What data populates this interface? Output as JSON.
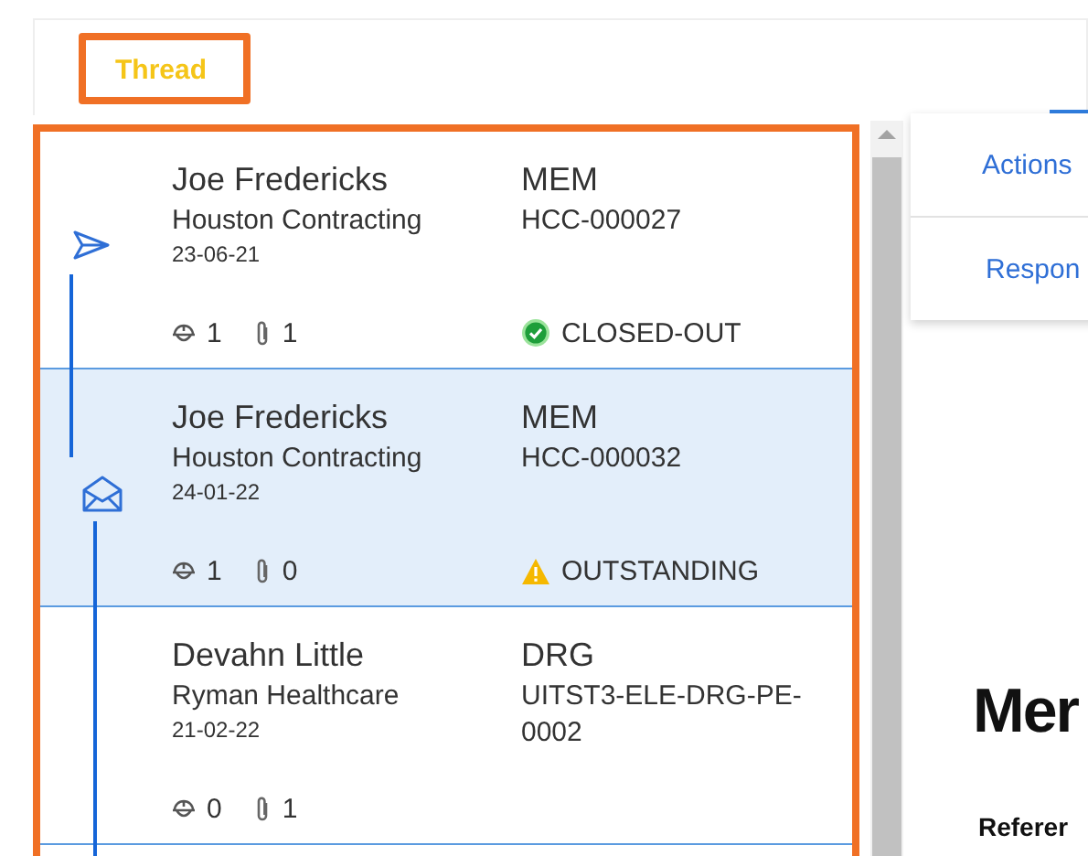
{
  "tabs": [
    {
      "label": "Thread",
      "selected": true,
      "highlighted": true
    }
  ],
  "thread": {
    "highlighted": true,
    "items": [
      {
        "kind": "sent",
        "sender": "Joe Fredericks",
        "company": "Houston Contracting",
        "date": "23-06-21",
        "doc_type": "MEM",
        "reference": "HCC-000027",
        "people_count": "1",
        "attachment_count": "1",
        "status": {
          "kind": "closed",
          "label": "CLOSED-OUT"
        },
        "selected": false
      },
      {
        "kind": "received",
        "sender": "Joe Fredericks",
        "company": "Houston Contracting",
        "date": "24-01-22",
        "doc_type": "MEM",
        "reference": "HCC-000032",
        "people_count": "1",
        "attachment_count": "0",
        "status": {
          "kind": "outstanding",
          "label": "OUTSTANDING"
        },
        "selected": true
      },
      {
        "kind": "none",
        "sender": "Devahn Little",
        "company": "Ryman Healthcare",
        "date": "21-02-22",
        "doc_type": "DRG",
        "reference": "UITST3-ELE-DRG-PE-0002",
        "people_count": "0",
        "attachment_count": "1",
        "selected": false
      }
    ]
  },
  "side_menu": [
    "Actions",
    "Respon"
  ],
  "document": {
    "title": "Mer",
    "reference_label": "Referer"
  }
}
